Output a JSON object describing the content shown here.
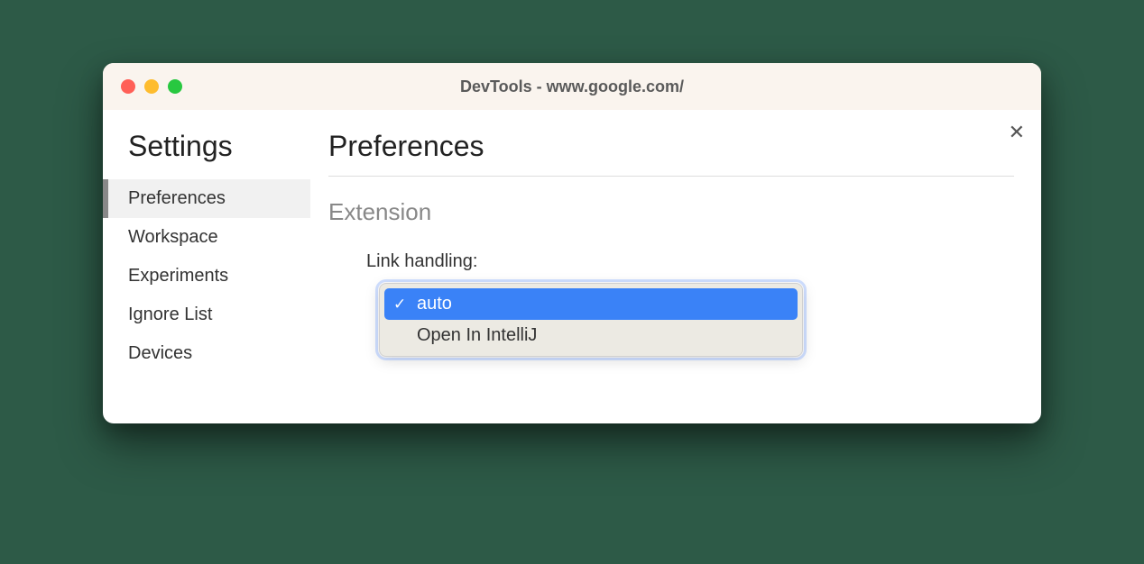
{
  "window": {
    "title": "DevTools - www.google.com/"
  },
  "sidebar": {
    "title": "Settings",
    "items": [
      {
        "label": "Preferences",
        "active": true
      },
      {
        "label": "Workspace",
        "active": false
      },
      {
        "label": "Experiments",
        "active": false
      },
      {
        "label": "Ignore List",
        "active": false
      },
      {
        "label": "Devices",
        "active": false
      }
    ]
  },
  "main": {
    "title": "Preferences",
    "section": {
      "title": "Extension",
      "setting": {
        "label": "Link handling:",
        "options": [
          {
            "label": "auto",
            "selected": true
          },
          {
            "label": "Open In IntelliJ",
            "selected": false
          }
        ]
      }
    }
  }
}
